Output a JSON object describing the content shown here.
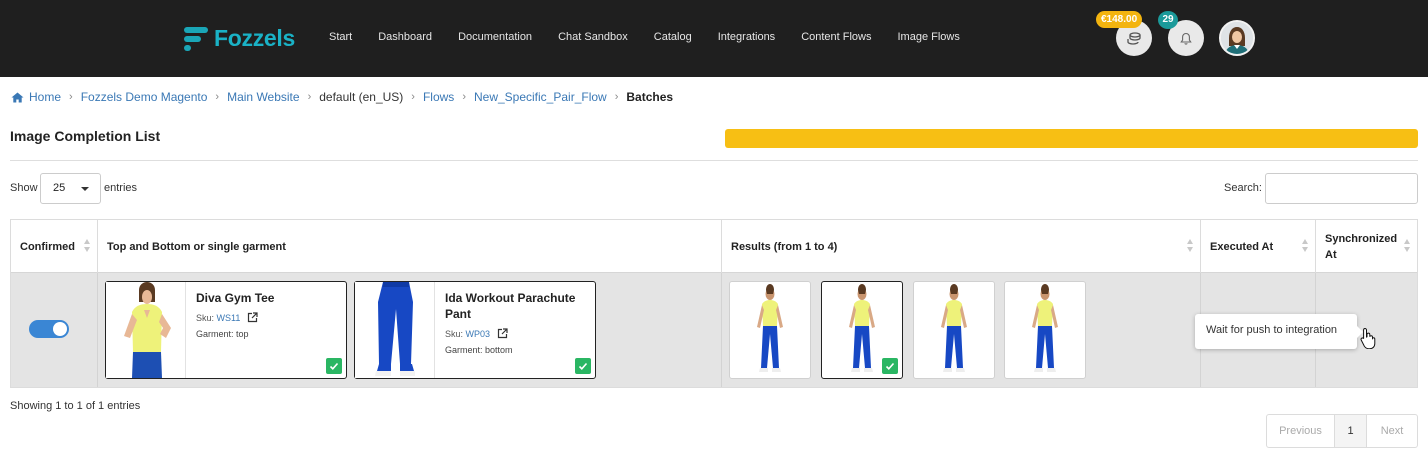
{
  "brand": {
    "name": "Fozzels",
    "accent": "#1ab2c6"
  },
  "nav": {
    "links": [
      "Start",
      "Dashboard",
      "Documentation",
      "Chat Sandbox",
      "Catalog",
      "Integrations",
      "Content Flows",
      "Image Flows"
    ],
    "balance": "€148.00",
    "notifications_count": "29",
    "credits_icon": "coins-icon",
    "bell_icon": "bell-icon"
  },
  "breadcrumb": {
    "items": [
      "Home",
      "Fozzels Demo Magento",
      "Main Website",
      "default (en_US)",
      "Flows",
      "New_Specific_Pair_Flow"
    ],
    "current": "Batches"
  },
  "page": {
    "title": "Image Completion List",
    "progress_fraction": 1.0,
    "progress_color": "#f7bf14"
  },
  "controls": {
    "show_label": "Show",
    "entries_value": "25",
    "entries_label": "entries",
    "search_label": "Search:",
    "search_value": ""
  },
  "table": {
    "headers": {
      "confirmed": "Confirmed",
      "garment": "Top and Bottom or single garment",
      "results": "Results (from 1 to 4)",
      "executed_at": "Executed At",
      "synchronized_at": "Synchronized At"
    },
    "row": {
      "confirmed": true,
      "garments": [
        {
          "name": "Diva Gym Tee",
          "sku_label": "Sku:",
          "sku": "WS11",
          "garment_label": "Garment:",
          "garment_type": "top"
        },
        {
          "name": "Ida Workout Parachute Pant",
          "sku_label": "Sku:",
          "sku": "WP03",
          "garment_label": "Garment:",
          "garment_type": "bottom"
        }
      ],
      "results_count": 4,
      "selected_result": 2,
      "executed_at": "",
      "synchronized_at": ""
    },
    "tooltip": "Wait for push to integration"
  },
  "footer": {
    "showing": "Showing 1 to 1 of 1 entries",
    "prev": "Previous",
    "page": "1",
    "next": "Next"
  }
}
